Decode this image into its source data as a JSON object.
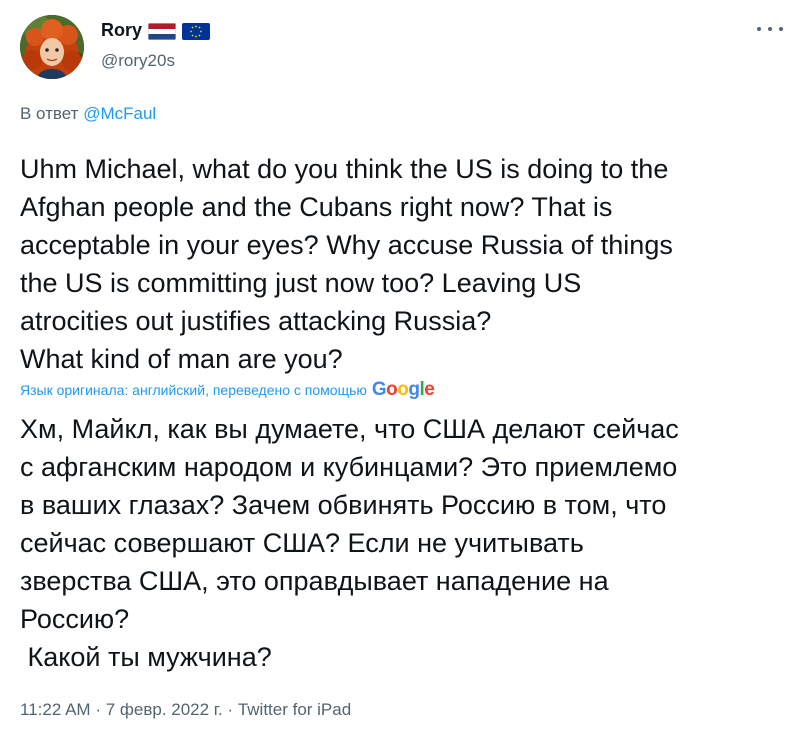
{
  "author": {
    "name": "Rory",
    "handle": "@rory20s",
    "flags": [
      "netherlands-flag",
      "eu-flag"
    ]
  },
  "reply": {
    "prefix": "В ответ",
    "mention": "@McFaul"
  },
  "tweet_text": [
    "Uhm Michael, what do you think the US is doing to the",
    "Afghan people and the Cubans right now? That is",
    "acceptable in your eyes? Why accuse Russia of things",
    "the US is committing just now too? Leaving US",
    "atrocities out justifies attacking Russia?",
    "What kind of man are you?"
  ],
  "translation": {
    "note": "Язык оригинала: английский, переведено с помощью",
    "provider": "Google",
    "lines": [
      "Хм, Майкл, как вы думаете, что США делают сейчас",
      "с афганским народом и кубинцами? Это приемлемо",
      "в ваших глазах? Зачем обвинять Россию в том, что",
      "сейчас совершают США? Если не учитывать",
      "зверства США, это оправдывает нападение на",
      "Россию?",
      " Какой ты мужчина?"
    ]
  },
  "meta": {
    "time": "11:22 AM",
    "separator": "·",
    "date": "7 февр. 2022 г.",
    "source": "Twitter for iPad"
  },
  "colors": {
    "text": "#0f1419",
    "secondary": "#536471",
    "link": "#1d9bf0"
  }
}
